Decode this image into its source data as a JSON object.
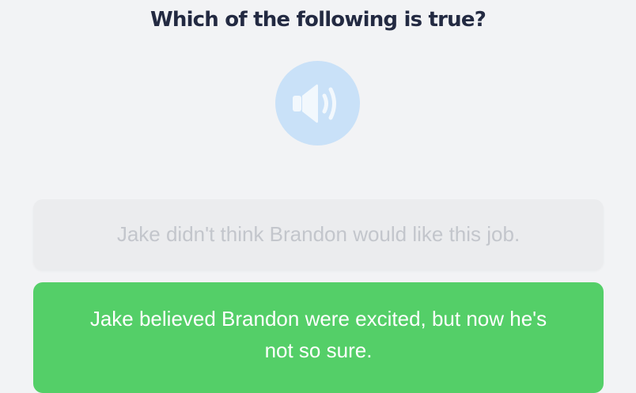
{
  "question": {
    "text": "Which of the following is true?"
  },
  "audio": {
    "icon": "speaker-icon",
    "color": "#c9e1f8"
  },
  "options": [
    {
      "text": "Jake didn't think Brandon would like this job.",
      "state": "disabled"
    },
    {
      "text": "Jake believed Brandon were excited, but now he's not so sure.",
      "state": "selected-correct",
      "color": "#54cf68"
    }
  ]
}
